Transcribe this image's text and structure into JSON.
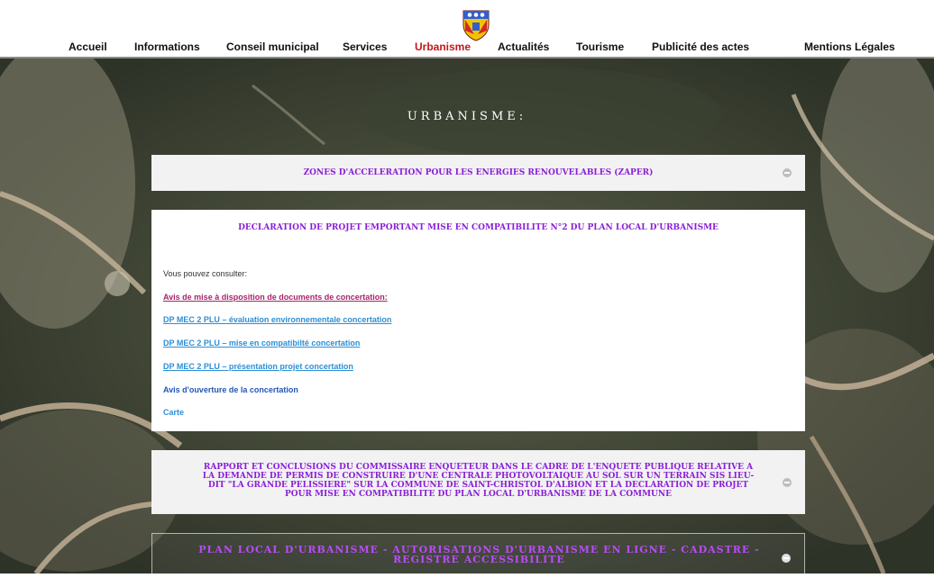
{
  "nav": {
    "items": [
      {
        "label": "Accueil"
      },
      {
        "label": "Informations"
      },
      {
        "label": "Conseil municipal"
      },
      {
        "label": "Services"
      },
      {
        "label": "Urbanisme"
      },
      {
        "label": "Actualités"
      },
      {
        "label": "Tourisme"
      },
      {
        "label": "Publicité des actes"
      },
      {
        "label": "Mentions Légales"
      }
    ],
    "active": "Urbanisme"
  },
  "page": {
    "title": "URBANISME:"
  },
  "sections": [
    {
      "title": "ZONES D'ACCELERATION POUR LES ENERGIES RENOUVELABLES (ZAPER)",
      "state": "collapsed"
    },
    {
      "title": "DECLARATION DE PROJET EMPORTANT MISE EN COMPATIBILITE N°2 DU PLAN LOCAL D'URBANISME",
      "state": "expanded",
      "intro": "Vous pouvez consulter:",
      "links": [
        {
          "label": "Avis de mise à disposition de documents de concertation:"
        },
        {
          "label": "DP MEC 2 PLU – évaluation environnementale concertation"
        },
        {
          "label": "DP MEC 2 PLU – mise en compatibilté concertation"
        },
        {
          "label": "DP MEC 2 PLU – présentation projet concertation"
        },
        {
          "label": "Avis d'ouverture de la concertation"
        },
        {
          "label": "Carte"
        }
      ]
    },
    {
      "title": "RAPPORT ET CONCLUSIONS DU COMMISSAIRE ENQUETEUR DANS LE CADRE DE L'ENQUETE PUBLIQUE RELATIVE A LA DEMANDE DE PERMIS DE CONSTRUIRE D'UNE CENTRALE PHOTOVOLTAIQUE AU SOL SUR UN TERRAIN SIS LIEU-DIT \"LA GRANDE PELISSIERE\" SUR LA COMMUNE DE SAINT-CHRISTOL D'ALBION ET LA DECLARATION DE PROJET POUR MISE EN COMPATIBILITE DU PLAN LOCAL D'URBANISME DE LA COMMUNE",
      "state": "collapsed"
    },
    {
      "title": "PLAN LOCAL D'URBANISME - AUTORISATIONS D'URBANISME EN LIGNE - CADASTRE - REGISTRE ACCESSIBILITE",
      "state": "collapsed"
    }
  ],
  "colors": {
    "accent": "#c4161c",
    "section_title": "#8a1fd8",
    "link": "#2d8fd5",
    "link_highlight": "#a8236a"
  },
  "icons": {
    "crest": "municipal-crest-icon",
    "toggle": "minus-circle-icon"
  }
}
